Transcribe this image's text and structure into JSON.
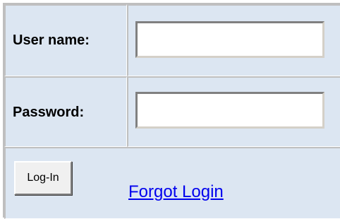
{
  "form": {
    "username": {
      "label": "User name:",
      "value": ""
    },
    "password": {
      "label": "Password:",
      "value": ""
    },
    "login_button_label": "Log-In",
    "forgot_link_text": "Forgot Login"
  },
  "colors": {
    "cell_background": "#dce6f2",
    "border": "#bfbfbf",
    "link": "#0000ee"
  }
}
